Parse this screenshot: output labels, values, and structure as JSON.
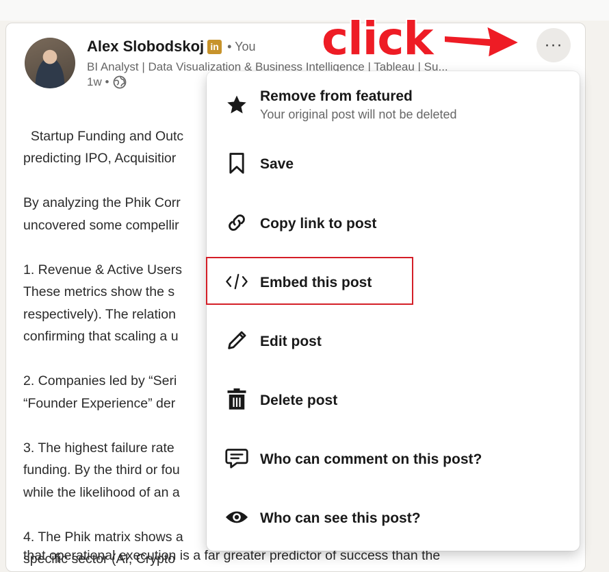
{
  "post": {
    "author_name": "Alex Slobodskoj",
    "badge": "in",
    "you_label": "• You",
    "headline": "BI Analyst | Data Visualization & Business Intelligence | Tableau | Su...",
    "time": "1w •",
    "body": [
      "Startup Funding and Outc",
      "predicting IPO, Acquisitior",
      "",
      "By analyzing the Phik Corr",
      "uncovered some compellir",
      "",
      "1. Revenue & Active Users",
      "These metrics show the s",
      "respectively). The relation",
      "confirming that scaling a u",
      "",
      "2. Companies led by “Seri",
      "“Founder Experience” der",
      "",
      "3. The highest failure rate",
      "funding. By the third or fou",
      "while the likelihood of an a",
      "",
      "4. The Phik matrix shows a",
      "specific sector (AI, Crypto",
      "that operational execution is a far greater predictor of success than the"
    ]
  },
  "more_button": {
    "label": "···"
  },
  "annotation": {
    "text": "click",
    "color": "#ee1c25"
  },
  "menu": {
    "items": [
      {
        "icon": "star-icon",
        "label": "Remove from featured",
        "sublabel": "Your original post will not be deleted"
      },
      {
        "icon": "bookmark-icon",
        "label": "Save"
      },
      {
        "icon": "link-icon",
        "label": "Copy link to post"
      },
      {
        "icon": "code-icon",
        "label": "Embed this post",
        "highlighted": true
      },
      {
        "icon": "pencil-icon",
        "label": "Edit post"
      },
      {
        "icon": "trash-icon",
        "label": "Delete post"
      },
      {
        "icon": "comment-icon",
        "label": "Who can comment on this post?"
      },
      {
        "icon": "eye-icon",
        "label": "Who can see this post?"
      }
    ]
  },
  "colors": {
    "annotation_red": "#ee1c25",
    "badge_gold": "#c7932b",
    "highlight_border": "#d41e27"
  }
}
